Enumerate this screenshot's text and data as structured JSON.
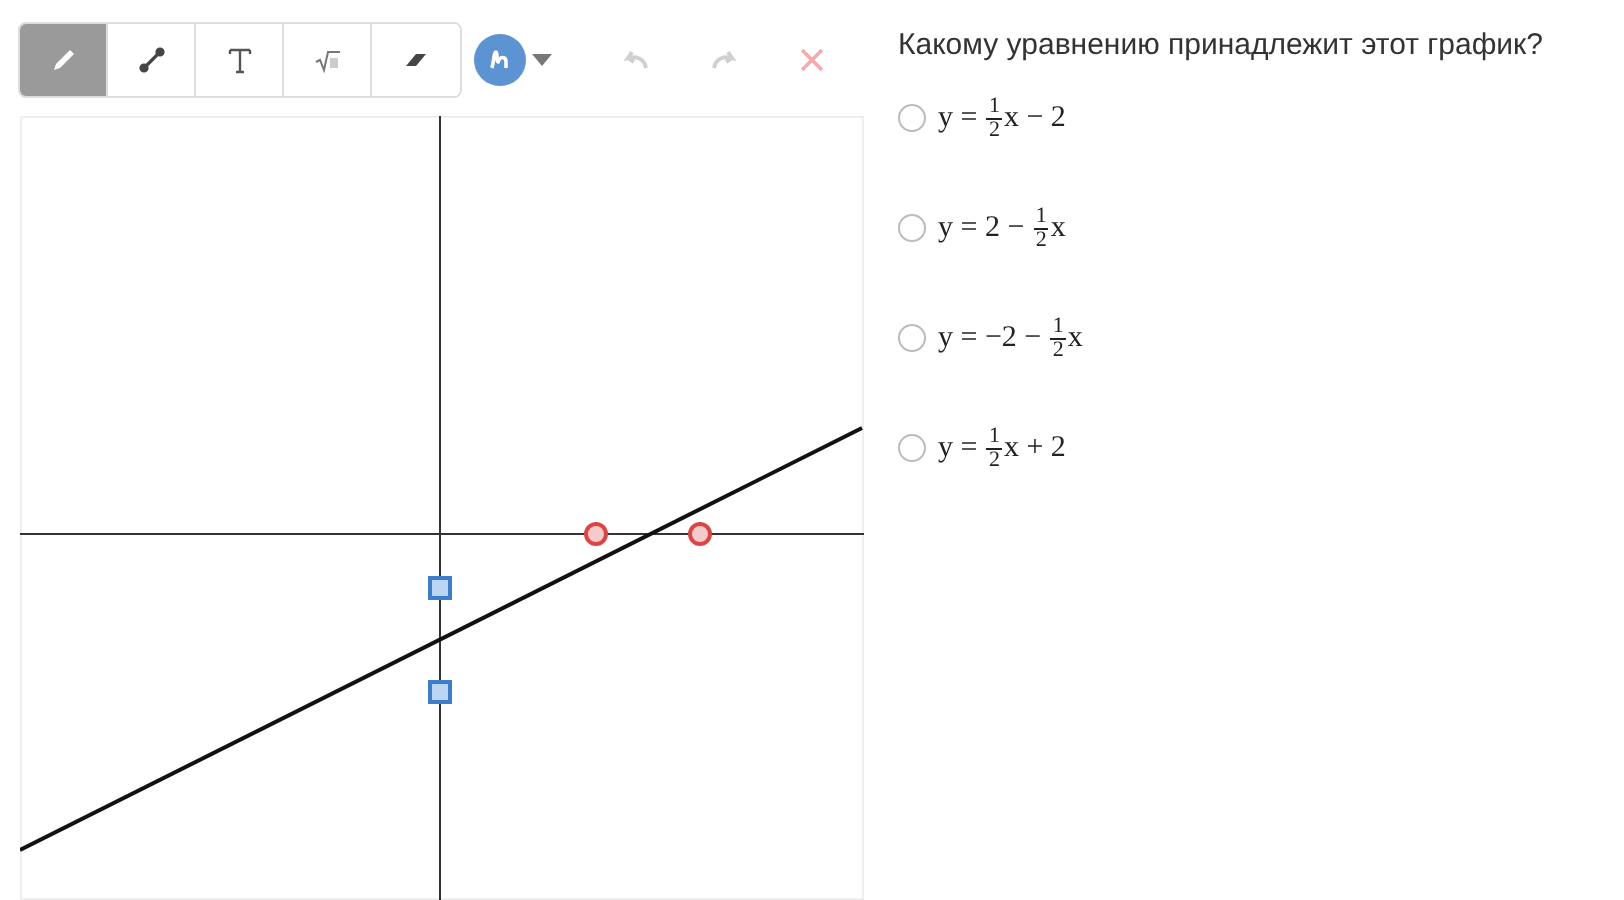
{
  "toolbar": {
    "tools": [
      {
        "kind": "pencil",
        "selected": true
      },
      {
        "kind": "line",
        "selected": false
      },
      {
        "kind": "text",
        "selected": false
      },
      {
        "kind": "sqrt",
        "selected": false
      },
      {
        "kind": "eraser",
        "selected": false
      }
    ],
    "color": "#5b93d3",
    "actions": [
      {
        "kind": "undo",
        "disabled": true
      },
      {
        "kind": "redo",
        "disabled": true
      },
      {
        "kind": "clear",
        "disabled": true
      }
    ]
  },
  "question": "Какому уравнению принадлежит этот график?",
  "options": [
    {
      "before": "y = ",
      "num": "1",
      "den": "2",
      "after": "x − 2",
      "selected": false
    },
    {
      "before": "y = 2 − ",
      "num": "1",
      "den": "2",
      "after": "x",
      "selected": false
    },
    {
      "before": "y = −2 − ",
      "num": "1",
      "den": "2",
      "after": "x",
      "selected": false
    },
    {
      "before": "y = ",
      "num": "1",
      "den": "2",
      "after": "x + 2",
      "selected": false
    }
  ]
}
